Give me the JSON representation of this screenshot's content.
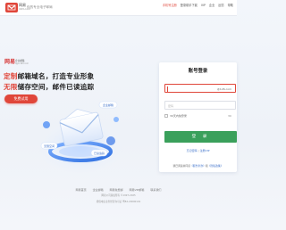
{
  "header": {
    "logo_text": "网易",
    "logo_sub": "163.com",
    "slogan": "你的专业电子邮局",
    "nav": [
      {
        "label": "手机号注册",
        "active": true
      },
      {
        "label": "登录助手下载",
        "active": false
      },
      {
        "label": "VIP",
        "active": false
      },
      {
        "label": "企业",
        "active": false
      },
      {
        "label": "反馈",
        "active": false
      },
      {
        "label": "帮助",
        "active": false
      }
    ]
  },
  "hero": {
    "brand_mark": "网易",
    "brand_mini": "企业邮箱",
    "brand_mini2": "qiye.163.com",
    "title_line1_a": "定制",
    "title_line1_b": "邮箱域名，打造专业形象",
    "title_line2_a": "无限",
    "title_line2_b": "储存空间，邮件已读追踪",
    "cta_label": "免费试用"
  },
  "illustration": {
    "tag1": "企业邮箱",
    "tag2": "已读追踪",
    "tag3": "无限空间"
  },
  "login": {
    "title": "账号登录",
    "username_suffix": "@126.com",
    "password_placeholder": "密码",
    "remember_label": "30天内免登录",
    "remember_time": "30",
    "submit_label": "登 录",
    "link_forgot": "忘记密码",
    "link_register": "注册VIP",
    "agreement_prefix": "我已阅读并同意",
    "agreement_terms": "《服务条款》",
    "agreement_and": "和",
    "agreement_privacy": "《隐私政策》"
  },
  "footer": {
    "links": [
      "网易首页",
      "企业邮箱",
      "网易免费邮",
      "网易VIP邮箱",
      "联系我们"
    ],
    "line2": "网易公司版权所有 ©1997-2025",
    "line3": "增值电信业务经营许可证 粤B2-20090191"
  },
  "colors": {
    "accent": "#e0463a",
    "primary": "#3aa05b",
    "link": "#3b6fc9"
  }
}
